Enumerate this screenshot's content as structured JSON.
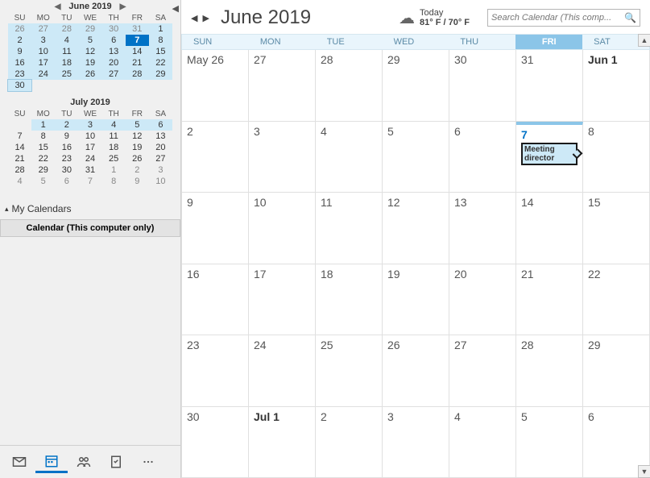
{
  "sidebar": {
    "mini1": {
      "title": "June 2019",
      "dow": [
        "SU",
        "MO",
        "TU",
        "WE",
        "TH",
        "FR",
        "SA"
      ],
      "days": [
        {
          "n": 26,
          "cls": "hl faded"
        },
        {
          "n": 27,
          "cls": "hl faded"
        },
        {
          "n": 28,
          "cls": "hl faded"
        },
        {
          "n": 29,
          "cls": "hl faded"
        },
        {
          "n": 30,
          "cls": "hl faded"
        },
        {
          "n": 31,
          "cls": "hl faded"
        },
        {
          "n": 1,
          "cls": "hl"
        },
        {
          "n": 2,
          "cls": "hl"
        },
        {
          "n": 3,
          "cls": "hl"
        },
        {
          "n": 4,
          "cls": "hl"
        },
        {
          "n": 5,
          "cls": "hl"
        },
        {
          "n": 6,
          "cls": "hl"
        },
        {
          "n": 7,
          "cls": "today"
        },
        {
          "n": 8,
          "cls": "hl"
        },
        {
          "n": 9,
          "cls": "hl"
        },
        {
          "n": 10,
          "cls": "hl"
        },
        {
          "n": 11,
          "cls": "hl"
        },
        {
          "n": 12,
          "cls": "hl"
        },
        {
          "n": 13,
          "cls": "hl"
        },
        {
          "n": 14,
          "cls": "hl"
        },
        {
          "n": 15,
          "cls": "hl"
        },
        {
          "n": 16,
          "cls": "hl"
        },
        {
          "n": 17,
          "cls": "hl"
        },
        {
          "n": 18,
          "cls": "hl"
        },
        {
          "n": 19,
          "cls": "hl"
        },
        {
          "n": 20,
          "cls": "hl"
        },
        {
          "n": 21,
          "cls": "hl"
        },
        {
          "n": 22,
          "cls": "hl"
        },
        {
          "n": 23,
          "cls": "hl"
        },
        {
          "n": 24,
          "cls": "hl"
        },
        {
          "n": 25,
          "cls": "hl"
        },
        {
          "n": 26,
          "cls": "hl"
        },
        {
          "n": 27,
          "cls": "hl"
        },
        {
          "n": 28,
          "cls": "hl"
        },
        {
          "n": 29,
          "cls": "hl"
        },
        {
          "n": 30,
          "cls": "hl box"
        }
      ]
    },
    "mini2": {
      "title": "July 2019",
      "dow": [
        "SU",
        "MO",
        "TU",
        "WE",
        "TH",
        "FR",
        "SA"
      ],
      "days": [
        {
          "n": "",
          "cls": ""
        },
        {
          "n": 1,
          "cls": "hl"
        },
        {
          "n": 2,
          "cls": "hl"
        },
        {
          "n": 3,
          "cls": "hl"
        },
        {
          "n": 4,
          "cls": "hl"
        },
        {
          "n": 5,
          "cls": "hl"
        },
        {
          "n": 6,
          "cls": "hl"
        },
        {
          "n": 7,
          "cls": ""
        },
        {
          "n": 8,
          "cls": ""
        },
        {
          "n": 9,
          "cls": ""
        },
        {
          "n": 10,
          "cls": ""
        },
        {
          "n": 11,
          "cls": ""
        },
        {
          "n": 12,
          "cls": ""
        },
        {
          "n": 13,
          "cls": ""
        },
        {
          "n": 14,
          "cls": ""
        },
        {
          "n": 15,
          "cls": ""
        },
        {
          "n": 16,
          "cls": ""
        },
        {
          "n": 17,
          "cls": ""
        },
        {
          "n": 18,
          "cls": ""
        },
        {
          "n": 19,
          "cls": ""
        },
        {
          "n": 20,
          "cls": ""
        },
        {
          "n": 21,
          "cls": ""
        },
        {
          "n": 22,
          "cls": ""
        },
        {
          "n": 23,
          "cls": ""
        },
        {
          "n": 24,
          "cls": ""
        },
        {
          "n": 25,
          "cls": ""
        },
        {
          "n": 26,
          "cls": ""
        },
        {
          "n": 27,
          "cls": ""
        },
        {
          "n": 28,
          "cls": ""
        },
        {
          "n": 29,
          "cls": ""
        },
        {
          "n": 30,
          "cls": ""
        },
        {
          "n": 31,
          "cls": ""
        },
        {
          "n": 1,
          "cls": "faded"
        },
        {
          "n": 2,
          "cls": "faded"
        },
        {
          "n": 3,
          "cls": "faded"
        },
        {
          "n": 4,
          "cls": "faded"
        },
        {
          "n": 5,
          "cls": "faded"
        },
        {
          "n": 6,
          "cls": "faded"
        },
        {
          "n": 7,
          "cls": "faded"
        },
        {
          "n": 8,
          "cls": "faded"
        },
        {
          "n": 9,
          "cls": "faded"
        },
        {
          "n": 10,
          "cls": "faded"
        }
      ]
    },
    "section_label": "My Calendars",
    "calendar_item": "Calendar (This computer only)"
  },
  "header": {
    "title": "June 2019",
    "weather_label": "Today",
    "weather_temp": "81° F / 70° F",
    "search_placeholder": "Search Calendar (This comp..."
  },
  "dow": [
    "SUN",
    "MON",
    "TUE",
    "WED",
    "THU",
    "FRI",
    "SAT"
  ],
  "today_col_index": 5,
  "grid": [
    {
      "label": "May 26"
    },
    {
      "label": "27"
    },
    {
      "label": "28"
    },
    {
      "label": "29"
    },
    {
      "label": "30"
    },
    {
      "label": "31"
    },
    {
      "label": "Jun 1",
      "bold": true
    },
    {
      "label": "2"
    },
    {
      "label": "3"
    },
    {
      "label": "4"
    },
    {
      "label": "5"
    },
    {
      "label": "6"
    },
    {
      "label": "7",
      "today": true,
      "event": "Meeting director"
    },
    {
      "label": "8"
    },
    {
      "label": "9"
    },
    {
      "label": "10"
    },
    {
      "label": "11"
    },
    {
      "label": "12"
    },
    {
      "label": "13"
    },
    {
      "label": "14"
    },
    {
      "label": "15"
    },
    {
      "label": "16"
    },
    {
      "label": "17"
    },
    {
      "label": "18"
    },
    {
      "label": "19"
    },
    {
      "label": "20"
    },
    {
      "label": "21"
    },
    {
      "label": "22"
    },
    {
      "label": "23"
    },
    {
      "label": "24"
    },
    {
      "label": "25"
    },
    {
      "label": "26"
    },
    {
      "label": "27"
    },
    {
      "label": "28"
    },
    {
      "label": "29"
    },
    {
      "label": "30"
    },
    {
      "label": "Jul 1",
      "bold": true
    },
    {
      "label": "2"
    },
    {
      "label": "3"
    },
    {
      "label": "4"
    },
    {
      "label": "5"
    },
    {
      "label": "6"
    }
  ]
}
